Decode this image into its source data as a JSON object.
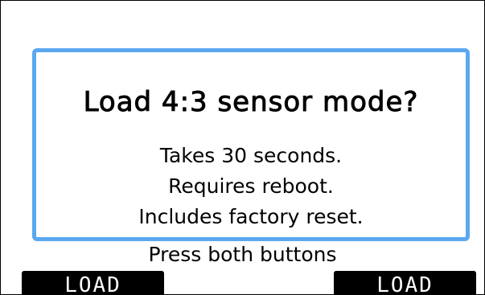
{
  "dialog": {
    "title": "Load 4:3 sensor mode?",
    "lines": [
      "Takes 30 seconds.",
      "Requires reboot.",
      "Includes factory reset."
    ]
  },
  "hint": "Press both buttons",
  "softkeys": {
    "left_label": "LOAD",
    "right_label": "LOAD"
  },
  "colors": {
    "dialog_border": "#5aa8f0",
    "softkey_bg": "#000000",
    "softkey_text": "#ffffff"
  }
}
